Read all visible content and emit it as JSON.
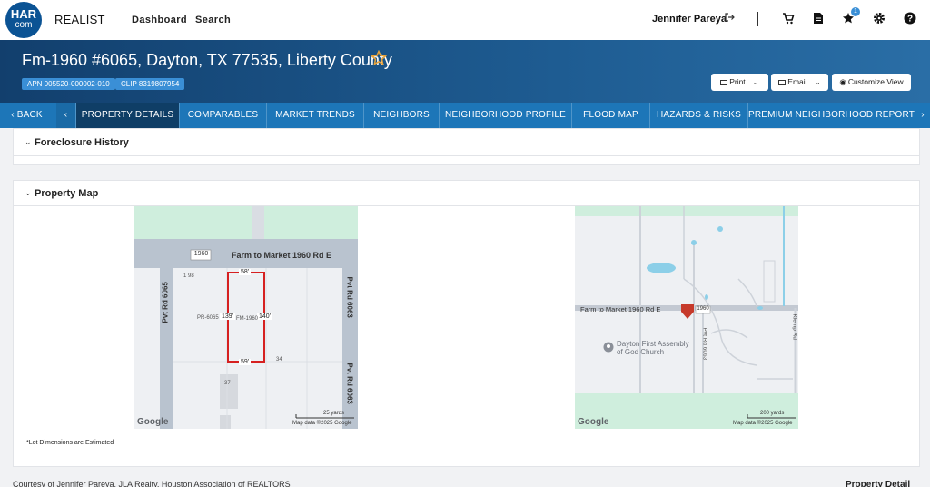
{
  "topbar": {
    "logo_line1": "HAR",
    "logo_line2": "com",
    "brand": "REALIST",
    "nav": [
      "Dashboard",
      "Search"
    ],
    "user_name": "Jennifer Pareya",
    "favorites_badge": "1",
    "icons": [
      "logout-icon",
      "cart-icon",
      "document-icon",
      "star-icon",
      "gear-icon",
      "help-icon"
    ]
  },
  "header": {
    "title": "Fm-1960 #6065, Dayton, TX 77535, Liberty County",
    "apn": "APN 005520-000002-010",
    "clip": "CLIP 8319807954",
    "print": "Print",
    "email": "Email",
    "customize": "Customize View"
  },
  "tabs": {
    "back": "BACK",
    "items": [
      "PROPERTY DETAILS",
      "COMPARABLES",
      "MARKET TRENDS",
      "NEIGHBORS",
      "NEIGHBORHOOD PROFILE",
      "FLOOD MAP",
      "HAZARDS & RISKS",
      "PREMIUM NEIGHBORHOOD REPORTS"
    ],
    "active": "PROPERTY DETAILS"
  },
  "sections": {
    "foreclosure": "Foreclosure History",
    "map": "Property Map"
  },
  "map_left": {
    "road": "Farm to Market 1960 Rd E",
    "route": "1960",
    "pvt_left": "Pvt Rd 6065",
    "pvt_right": "Pvt Rd 6063",
    "dim_top": "58'",
    "dim_left": "139'",
    "dim_right": "140'",
    "dim_bottom": "59'",
    "lbl_198": "1 98",
    "lbl_pr": "PR-6065",
    "lbl_fm": "FM-1960",
    "lbl_34": "34",
    "lbl_37": "37",
    "scale": "25 yards",
    "google": "Google",
    "mapdata": "Map data ©2025 Google"
  },
  "map_right": {
    "road": "Farm to Market 1960 Rd E",
    "route": "1960",
    "pvt": "Pvt Rd 6063",
    "klemp": "Klemp Rd",
    "church_line1": "Dayton First Assembly",
    "church_line2": "of God Church",
    "scale": "200 yards",
    "google": "Google",
    "mapdata": "Map data ©2025 Google"
  },
  "note": "*Lot Dimensions are Estimated",
  "footer": {
    "courtesy": "Courtesy of Jennifer Pareya, JLA Realty, Houston Association of REALTORS",
    "right": "Property Detail"
  }
}
